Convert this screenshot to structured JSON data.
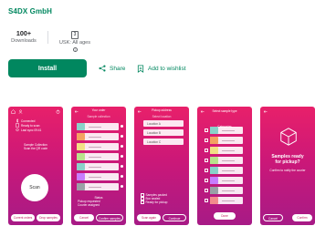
{
  "developer": "S4DX GmbH",
  "stats": {
    "downloads_value": "100+",
    "downloads_label": "Downloads",
    "rating_badge": "3",
    "rating_label": "USK: All ages",
    "rating_info": "i"
  },
  "actions": {
    "install": "Install",
    "share": "Share",
    "wishlist": "Add to wishlist"
  },
  "screenshots": [
    {
      "info_lines": [
        "Connected",
        "Ready to scan",
        "Last sync 09:41"
      ],
      "heading_lines": [
        "Sample Collection",
        "Scan the QR code"
      ],
      "scan_label": "Scan",
      "buttons": [
        "Current orders",
        "Drop samples"
      ]
    },
    {
      "title_line": "Your order",
      "subtitle_line": "Sample collection",
      "status_lines": [
        "Status",
        "Pickup requested",
        "Courier assigned"
      ],
      "buttons": [
        "Cancel",
        "Confirm samples"
      ]
    },
    {
      "title_line": "Pickup address",
      "subtitle_line": "Select location",
      "row_labels": [
        "Location A",
        "Location B",
        "Location C"
      ],
      "check_lines": [
        "Samples packed",
        "Box sealed",
        "Ready for pickup"
      ],
      "buttons": [
        "Scan again",
        "Continue"
      ]
    },
    {
      "header": "Select sample type",
      "sub_header": "Categories",
      "buttons": [
        "Done"
      ]
    },
    {
      "question_lines": [
        "Samples ready",
        "for pickup?"
      ],
      "desc_lines": [
        "Confirm to notify the courier"
      ],
      "buttons": [
        "Cancel",
        "Confirm"
      ]
    }
  ],
  "colors": {
    "brand_green": "#01875f",
    "screenshot_top": "#e8206a",
    "screenshot_bottom": "#a71a86"
  }
}
